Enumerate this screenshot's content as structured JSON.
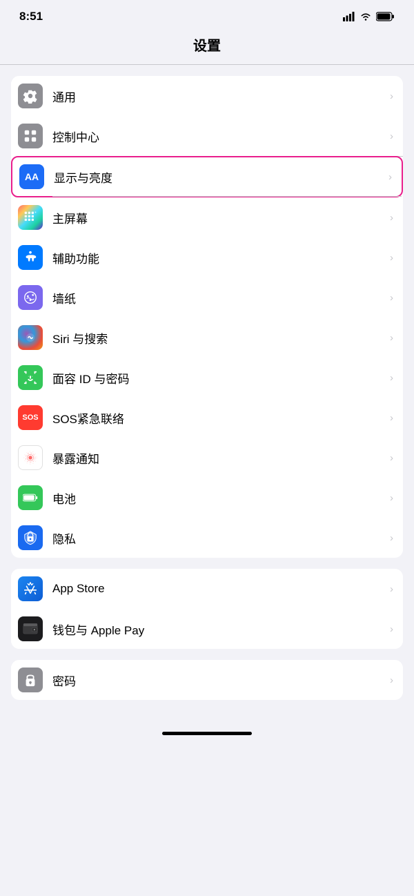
{
  "statusBar": {
    "time": "8:51"
  },
  "pageTitle": "设置",
  "groups": [
    {
      "id": "group1",
      "highlighted": false,
      "items": [
        {
          "id": "general",
          "label": "通用",
          "iconColor": "icon-gray",
          "iconSymbol": "⚙️"
        },
        {
          "id": "controlCenter",
          "label": "控制中心",
          "iconColor": "icon-gray2",
          "iconSymbol": "⊟"
        },
        {
          "id": "display",
          "label": "显示与亮度",
          "iconColor": "icon-blue",
          "iconSymbol": "AA",
          "highlighted": true
        },
        {
          "id": "homeScreen",
          "label": "主屏幕",
          "iconColor": "icon-colorful",
          "iconSymbol": "⊞"
        },
        {
          "id": "accessibility",
          "label": "辅助功能",
          "iconColor": "icon-blue2",
          "iconSymbol": "♿"
        },
        {
          "id": "wallpaper",
          "label": "墙纸",
          "iconColor": "icon-purple",
          "iconSymbol": "✿"
        },
        {
          "id": "siri",
          "label": "Siri 与搜索",
          "iconColor": "icon-siri",
          "iconSymbol": "🎙"
        },
        {
          "id": "faceId",
          "label": "面容 ID 与密码",
          "iconColor": "icon-green",
          "iconSymbol": "😊"
        },
        {
          "id": "sos",
          "label": "SOS紧急联络",
          "iconColor": "icon-red",
          "iconSymbol": "SOS"
        },
        {
          "id": "exposure",
          "label": "暴露通知",
          "iconColor": "icon-exposure",
          "iconSymbol": "⊛"
        },
        {
          "id": "battery",
          "label": "电池",
          "iconColor": "icon-battery",
          "iconSymbol": "🔋"
        },
        {
          "id": "privacy",
          "label": "隐私",
          "iconColor": "icon-privacy",
          "iconSymbol": "✋"
        }
      ]
    },
    {
      "id": "group2",
      "highlighted": false,
      "items": [
        {
          "id": "appStore",
          "label": "App Store",
          "iconColor": "icon-appstore",
          "iconSymbol": "A"
        },
        {
          "id": "wallet",
          "label": "钱包与 Apple Pay",
          "iconColor": "icon-wallet",
          "iconSymbol": "💳"
        }
      ]
    },
    {
      "id": "group3",
      "highlighted": false,
      "items": [
        {
          "id": "password",
          "label": "密码",
          "iconColor": "icon-password",
          "iconSymbol": "🔑"
        }
      ]
    }
  ]
}
